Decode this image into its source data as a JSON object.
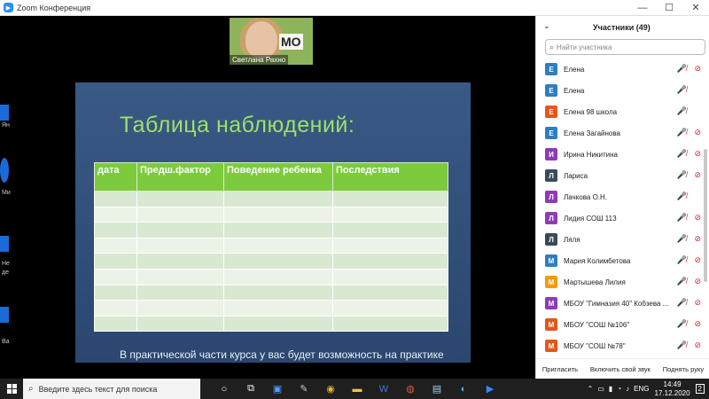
{
  "window": {
    "title": "Zoom Конференция",
    "min": "—",
    "max": "☐",
    "close": "✕"
  },
  "sidebar_labels": [
    "Ян",
    "Ми",
    "Не",
    "де",
    "Ва"
  ],
  "video": {
    "name": "Светлана Рахно",
    "badge": "MO"
  },
  "slide": {
    "title": "Таблица наблюдений:",
    "columns": [
      "дата",
      "Предш.фактор",
      "Поведение ребенка",
      "Последствия"
    ],
    "footer": "В практической части курса у вас будет возможность на практике"
  },
  "participants": {
    "title": "Участники (49)",
    "search_placeholder": "Найти участника",
    "list": [
      {
        "initial": "Е",
        "name": "Елена",
        "color": "#2d7fc1",
        "mic_off": true,
        "cam_off": true
      },
      {
        "initial": "Е",
        "name": "Елена",
        "color": "#2d7fc1",
        "mic_off": true,
        "cam_off": false
      },
      {
        "initial": "Е",
        "name": "Елена 98 школа",
        "color": "#e0591c",
        "mic_off": true,
        "cam_off": false
      },
      {
        "initial": "Е",
        "name": "Елена Загайнова",
        "color": "#2d7fc1",
        "mic_off": true,
        "cam_off": true
      },
      {
        "initial": "И",
        "name": "Ирина Никитина",
        "color": "#8c3bb5",
        "mic_off": true,
        "cam_off": true
      },
      {
        "initial": "Л",
        "name": "Лариса",
        "color": "#3a4a5a",
        "mic_off": true,
        "cam_off": true
      },
      {
        "initial": "Л",
        "name": "Лачкова О.Н.",
        "color": "#8c3bb5",
        "mic_off": true,
        "cam_off": false
      },
      {
        "initial": "Л",
        "name": "Лидия СОШ 113",
        "color": "#8c3bb5",
        "mic_off": true,
        "cam_off": true
      },
      {
        "initial": "Л",
        "name": "Ляля",
        "color": "#3a4a5a",
        "mic_off": true,
        "cam_off": true
      },
      {
        "initial": "М",
        "name": "Мария Колимбетова",
        "color": "#2d7fc1",
        "mic_off": true,
        "cam_off": true
      },
      {
        "initial": "М",
        "name": "Мартышева Лилия",
        "color": "#f29b15",
        "mic_off": true,
        "cam_off": true
      },
      {
        "initial": "М",
        "name": "МБОУ \"Гимназия 40\" Кобзева ...",
        "color": "#8c3bb5",
        "mic_off": true,
        "cam_off": true
      },
      {
        "initial": "М",
        "name": "МБОУ \"СОШ №106\"",
        "color": "#e0591c",
        "mic_off": true,
        "cam_off": true
      },
      {
        "initial": "М",
        "name": "МБОУ \"СОШ №78\"",
        "color": "#e0591c",
        "mic_off": true,
        "cam_off": true
      }
    ],
    "buttons": {
      "invite": "Пригласить",
      "unmute": "Включить свой звук",
      "raise_hand": "Поднять руку"
    }
  },
  "taskbar": {
    "search_placeholder": "Введите здесь текст для поиска",
    "lang": "ENG",
    "time": "14:49",
    "date": "17.12.2020",
    "notifications": "2"
  }
}
